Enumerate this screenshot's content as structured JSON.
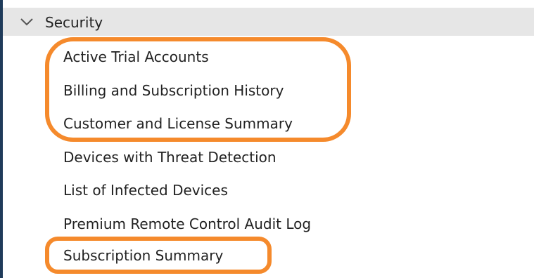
{
  "colors": {
    "highlight": "#f58a2c",
    "header_background": "#e6e6e6",
    "left_rail": "#1f3b5a",
    "text": "#222222"
  },
  "section": {
    "title": "Security",
    "toggle_icon": "chevron-down-icon",
    "expanded": true
  },
  "reports": [
    "Active Trial Accounts",
    "Billing and Subscription History",
    "Customer and License Summary",
    "Devices with Threat Detection",
    "List of Infected Devices",
    "Premium Remote Control Audit Log",
    "Subscription Summary"
  ]
}
